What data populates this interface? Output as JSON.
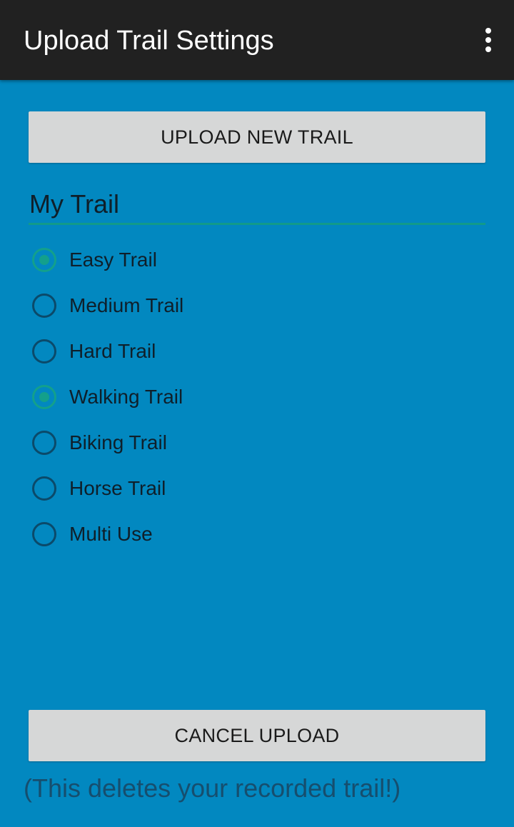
{
  "app_bar": {
    "title": "Upload Trail Settings",
    "overflow_icon": "more-vert-icon"
  },
  "main": {
    "upload_button_label": "UPLOAD NEW TRAIL",
    "section_title": "My Trail",
    "trail_options": [
      {
        "label": "Easy Trail",
        "checked": true
      },
      {
        "label": "Medium Trail",
        "checked": false
      },
      {
        "label": "Hard Trail",
        "checked": false
      },
      {
        "label": "Walking Trail",
        "checked": true
      },
      {
        "label": "Biking Trail",
        "checked": false
      },
      {
        "label": "Horse Trail",
        "checked": false
      },
      {
        "label": "Multi Use",
        "checked": false
      }
    ],
    "cancel_button_label": "CANCEL UPLOAD",
    "warning_text": "(This deletes your recorded trail!)"
  },
  "colors": {
    "app_bar_background": "#212121",
    "page_background": "#0288c0",
    "button_background": "#d6d7d7",
    "accent": "#13a08c"
  }
}
